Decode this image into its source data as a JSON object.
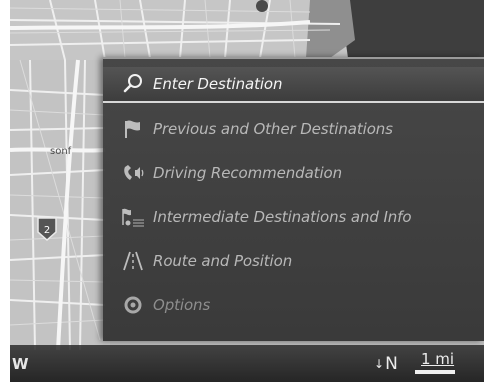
{
  "menu": {
    "items": [
      {
        "label": "Enter Destination",
        "icon": "search-icon",
        "state": "selected"
      },
      {
        "label": "Previous and Other Destinations",
        "icon": "flag-icon",
        "state": "normal"
      },
      {
        "label": "Driving Recommendation",
        "icon": "phone-voice-icon",
        "state": "normal"
      },
      {
        "label": "Intermediate Destinations and Info",
        "icon": "waypoints-icon",
        "state": "normal"
      },
      {
        "label": "Route and Position",
        "icon": "road-icon",
        "state": "normal"
      },
      {
        "label": "Options",
        "icon": "gear-icon",
        "state": "dim"
      }
    ]
  },
  "map": {
    "place_label": "sonf",
    "route_shield": "2",
    "status": {
      "heading_left": "W",
      "north_arrow": "↓",
      "north_label": "N",
      "scale_label": "1 mi"
    }
  },
  "colors": {
    "menu_text": "#b8b8b8",
    "selected_text": "#f4f4f4",
    "map_land": "#c9c9c9",
    "map_road": "#f2f2f2"
  }
}
